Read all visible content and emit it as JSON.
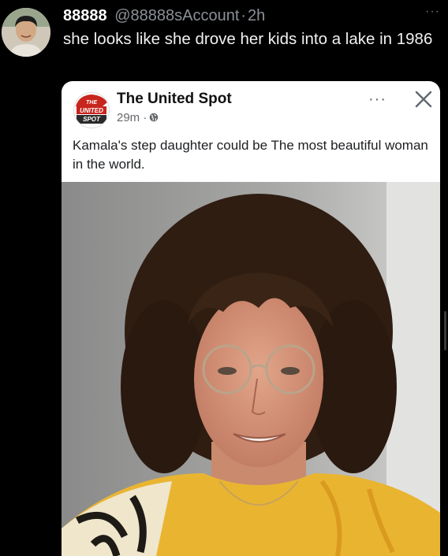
{
  "tweet": {
    "display_name": "88888",
    "handle": "@88888sAccount",
    "separator": "·",
    "time": "2h",
    "more_label": "···",
    "text": "she looks like she drove her kids into a lake in 1986"
  },
  "quoted_post": {
    "logo_lines": [
      "THE",
      "UNITED",
      "SPOT"
    ],
    "page_name": "The United Spot",
    "time": "29m ·",
    "more_label": "···",
    "text": "Kamala's step daughter could be The most beautiful woman in the world."
  },
  "colors": {
    "background": "#000000",
    "card": "#ffffff",
    "secondary_text": "#8b9096",
    "logo_red": "#c8251e"
  },
  "icons": {
    "tweet_more": "more-dots-icon",
    "globe": "globe-icon",
    "close": "close-icon",
    "post_more": "more-dots-icon"
  }
}
